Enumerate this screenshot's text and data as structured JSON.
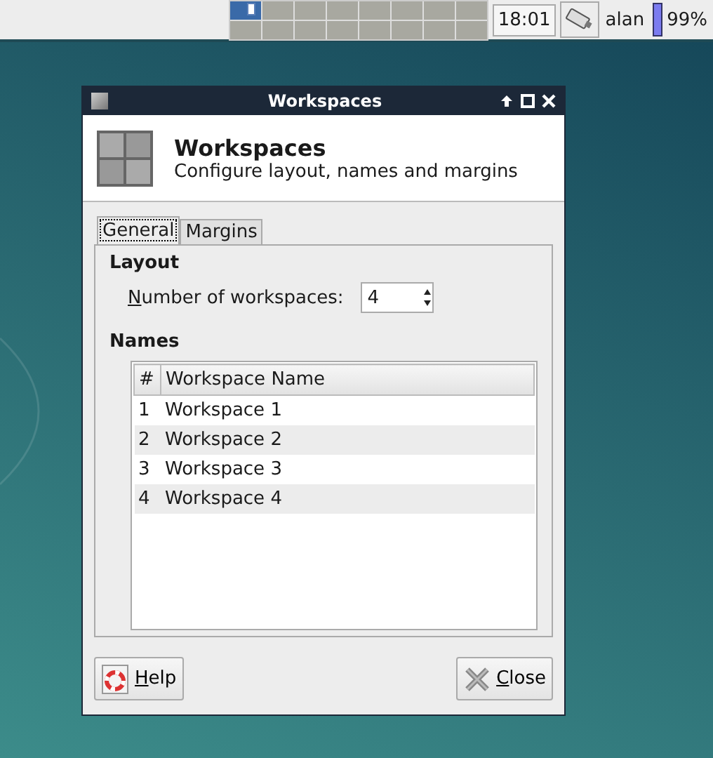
{
  "panel": {
    "workspaces": [
      {
        "selected": true
      },
      {
        "selected": false
      },
      {
        "selected": false
      },
      {
        "selected": false
      },
      {
        "selected": false
      },
      {
        "selected": false
      },
      {
        "selected": false
      },
      {
        "selected": false
      },
      {
        "selected": false
      },
      {
        "selected": false
      },
      {
        "selected": false
      },
      {
        "selected": false
      },
      {
        "selected": false
      },
      {
        "selected": false
      },
      {
        "selected": false
      },
      {
        "selected": false
      }
    ],
    "clock": "18:01",
    "user": "alan",
    "battery": {
      "level": 0.99,
      "reading": "99%"
    }
  },
  "window": {
    "title": "Workspaces"
  },
  "header": {
    "title": "Workspaces",
    "subtitle": "Configure layout, names and margins"
  },
  "tabs": [
    {
      "label": "General",
      "selected": true
    },
    {
      "label": "Margins",
      "selected": false
    }
  ],
  "layout": {
    "heading": "Layout",
    "label": "Number of workspaces:",
    "value": "4"
  },
  "names": {
    "heading": "Names",
    "columns": [
      "#",
      "Workspace Name"
    ],
    "rows": [
      [
        "1",
        "Workspace 1"
      ],
      [
        "2",
        "Workspace 2"
      ],
      [
        "3",
        "Workspace 3"
      ],
      [
        "4",
        "Workspace 4"
      ]
    ]
  },
  "buttons": [
    {
      "kind": "help",
      "label": "Help"
    },
    {
      "kind": "close",
      "label": "Close"
    }
  ]
}
